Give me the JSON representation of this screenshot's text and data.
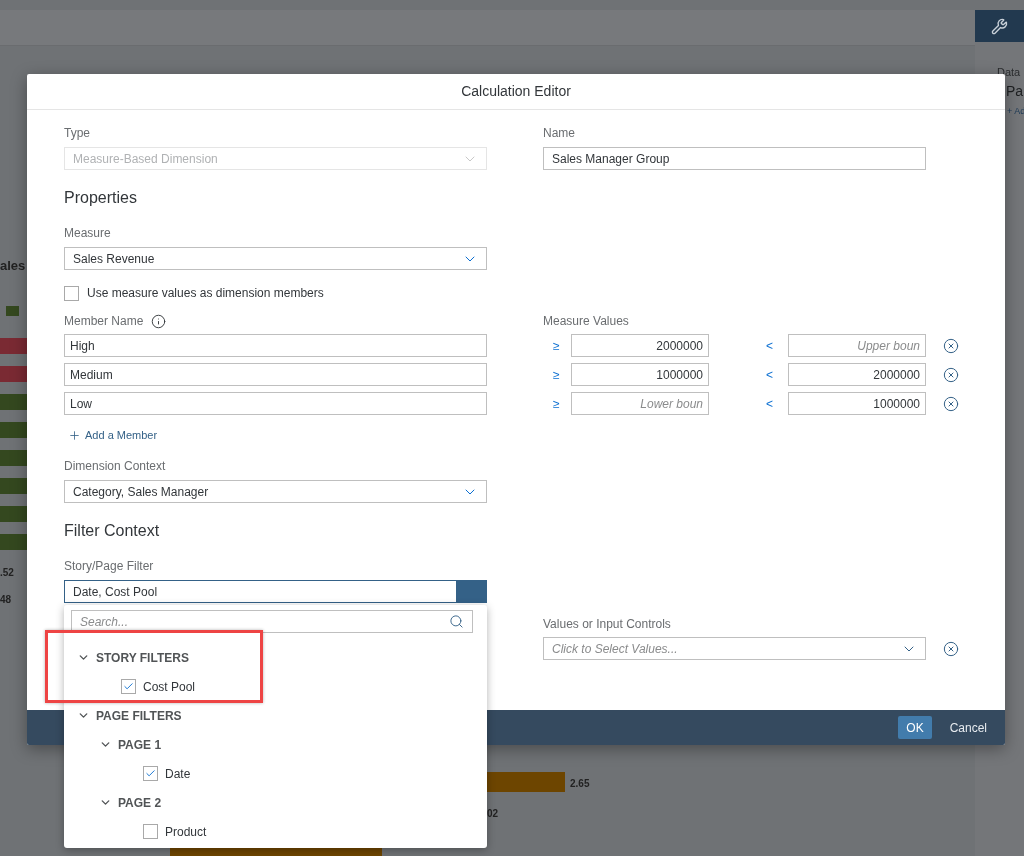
{
  "background": {
    "chart_label": "ales",
    "left_values": [
      ".52",
      "48"
    ],
    "bottom_values": [
      "2.65",
      "02"
    ],
    "side_panel": {
      "label": "Data",
      "title": "Pa",
      "link": "+ Ad"
    }
  },
  "dialog": {
    "title": "Calculation Editor",
    "type": {
      "label": "Type",
      "value": "Measure-Based Dimension",
      "disabled": true
    },
    "name": {
      "label": "Name",
      "value": "Sales Manager Group"
    },
    "properties_heading": "Properties",
    "measure": {
      "label": "Measure",
      "value": "Sales Revenue"
    },
    "use_measure_values": {
      "label": "Use measure values as dimension members",
      "checked": false
    },
    "member_name_label": "Member Name",
    "measure_values_label": "Measure Values",
    "members": [
      {
        "name": "High",
        "lower_op": "≥",
        "lower": {
          "value": "2000000"
        },
        "upper_op": "<",
        "upper": {
          "placeholder": "Upper boun"
        }
      },
      {
        "name": "Medium",
        "lower_op": "≥",
        "lower": {
          "value": "1000000"
        },
        "upper_op": "<",
        "upper": {
          "value": "2000000"
        }
      },
      {
        "name": "Low",
        "lower_op": "≥",
        "lower": {
          "placeholder": "Lower boun"
        },
        "upper_op": "<",
        "upper": {
          "value": "1000000"
        }
      }
    ],
    "add_member": "Add a Member",
    "dimension_context": {
      "label": "Dimension Context",
      "value": "Category, Sales Manager"
    },
    "filter_context_heading": "Filter Context",
    "story_page_filter": {
      "label": "Story/Page Filter",
      "value": "Date, Cost Pool",
      "expanded": true
    },
    "filter_popup": {
      "search_placeholder": "Search...",
      "tree": [
        {
          "label": "STORY FILTERS",
          "expanded": true,
          "highlighted": true,
          "children": [
            {
              "label": "Cost Pool",
              "checked": true
            }
          ]
        },
        {
          "label": "PAGE FILTERS",
          "expanded": true,
          "children": [
            {
              "label": "PAGE 1",
              "expanded": true,
              "children": [
                {
                  "label": "Date",
                  "checked": true
                }
              ]
            },
            {
              "label": "PAGE 2",
              "expanded": true,
              "children": [
                {
                  "label": "Product",
                  "checked": false
                }
              ]
            }
          ]
        }
      ]
    },
    "values_controls": {
      "label": "Values or Input Controls",
      "placeholder": "Click to Select Values..."
    },
    "buttons": [
      {
        "label": "OK",
        "kind": "primary"
      },
      {
        "label": "Cancel",
        "kind": "plain"
      }
    ]
  }
}
